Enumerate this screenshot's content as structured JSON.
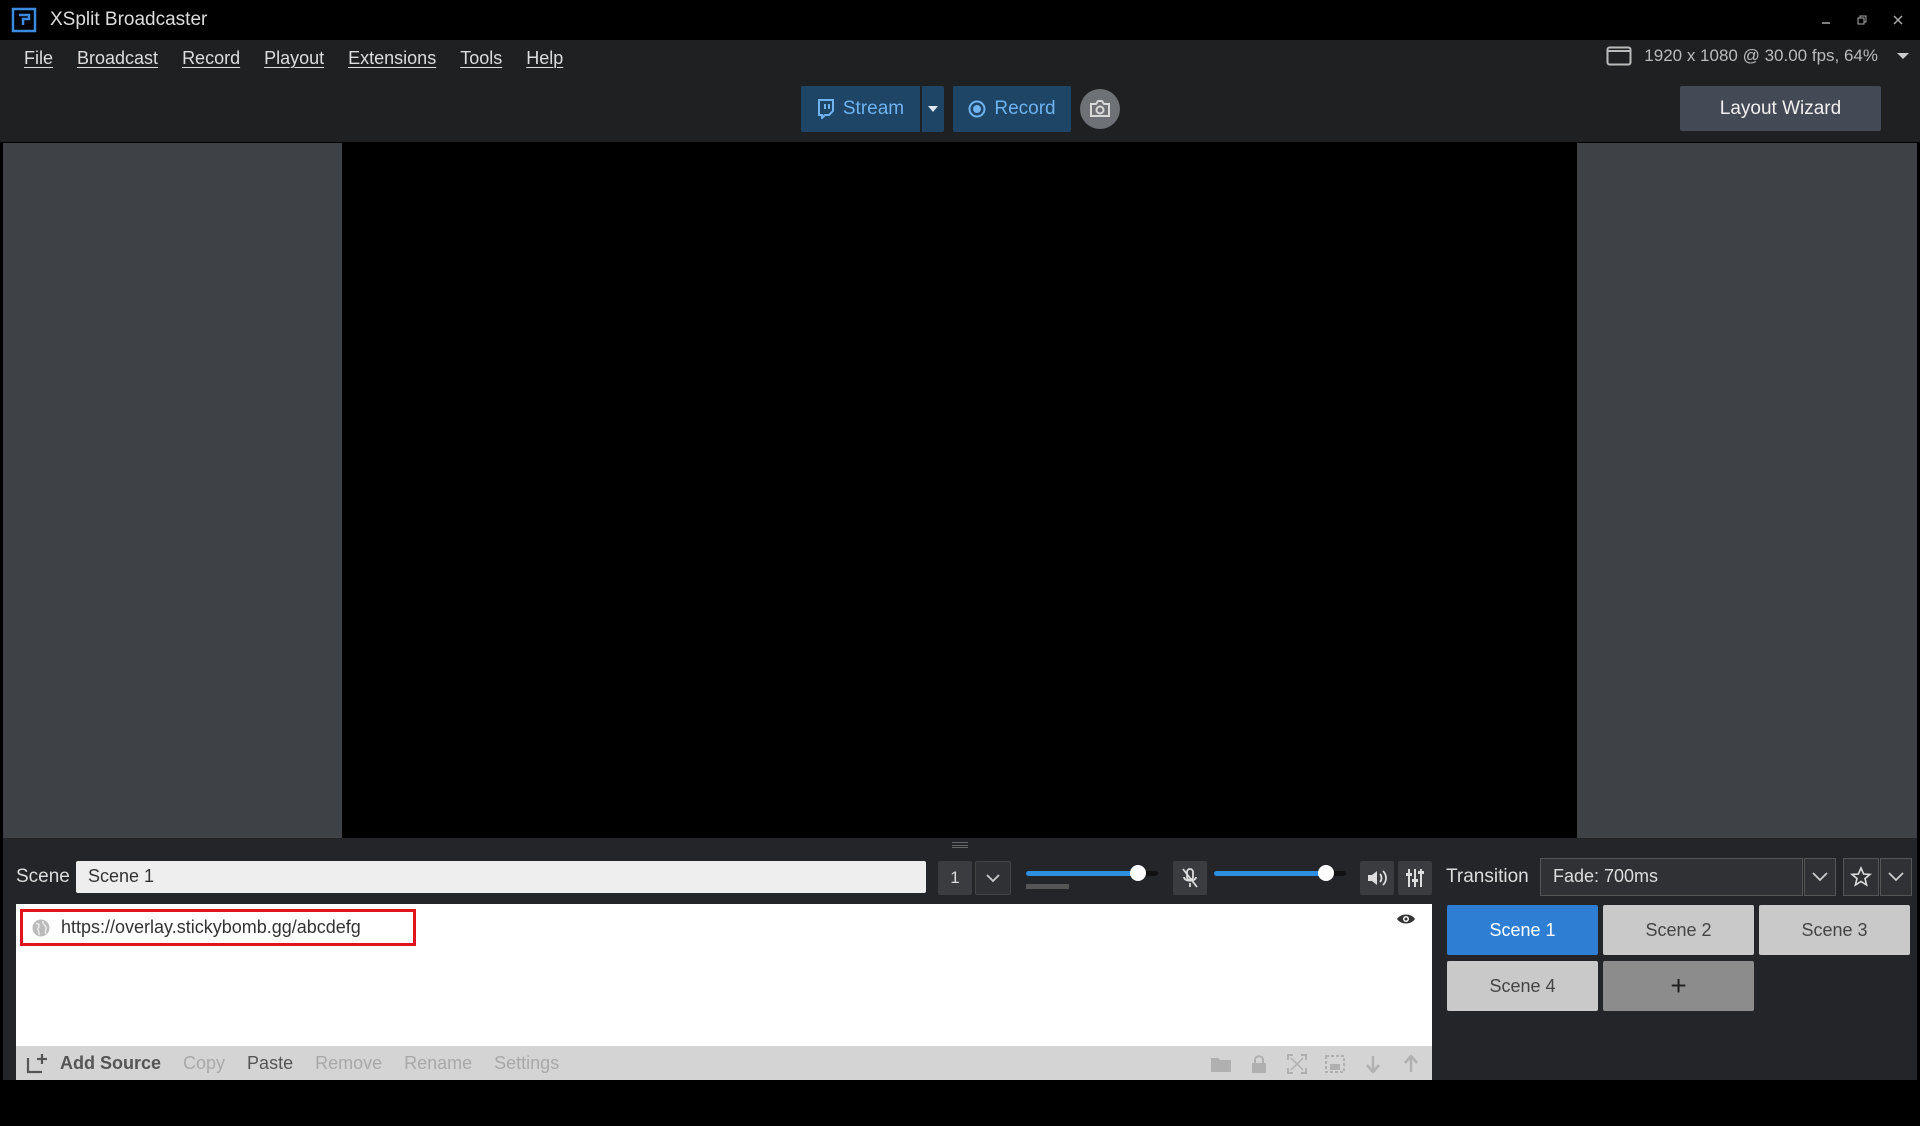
{
  "window": {
    "title": "XSplit Broadcaster"
  },
  "menu": {
    "items": [
      "File",
      "Broadcast",
      "Record",
      "Playout",
      "Extensions",
      "Tools",
      "Help"
    ],
    "resolution": "1920 x 1080 @ 30.00 fps, 64%"
  },
  "toolbar": {
    "stream_label": "Stream",
    "record_label": "Record",
    "layout_wizard_label": "Layout Wizard"
  },
  "scene_bar": {
    "label": "Scene",
    "name": "Scene 1",
    "number": "1",
    "mic_volume": 0.85,
    "speaker_volume": 0.85
  },
  "sources": {
    "items": [
      {
        "label": "https://overlay.stickybomb.gg/abcdefg",
        "icon": "globe-icon",
        "visible": true
      }
    ]
  },
  "source_toolbar": {
    "add_source": "Add Source",
    "copy": "Copy",
    "paste": "Paste",
    "remove": "Remove",
    "rename": "Rename",
    "settings": "Settings"
  },
  "transition": {
    "label": "Transition",
    "value": "Fade: 700ms"
  },
  "scenes": {
    "items": [
      "Scene 1",
      "Scene 2",
      "Scene 3",
      "Scene 4"
    ],
    "active": "Scene 1",
    "add_label": "+"
  },
  "colors": {
    "accent": "#2e7fd3",
    "stream_bg": "#1e4466",
    "highlight_border": "#e0141c"
  }
}
